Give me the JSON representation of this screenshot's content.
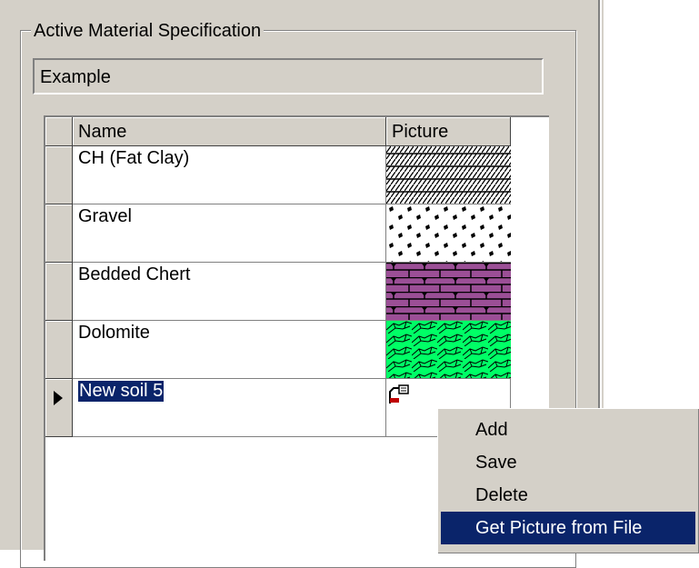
{
  "group": {
    "title": "Active Material Specification"
  },
  "name_field": {
    "value": "Example"
  },
  "grid": {
    "columns": [
      "Name",
      "Picture"
    ],
    "rows": [
      {
        "name": "CH (Fat Clay)",
        "pattern": "diagonal-hatch-icon"
      },
      {
        "name": "Gravel",
        "pattern": "gravel-dots-icon"
      },
      {
        "name": "Bedded Chert",
        "pattern": "chert-brick-icon"
      },
      {
        "name": "Dolomite",
        "pattern": "dolomite-cells-icon"
      },
      {
        "name": "New soil 5",
        "pattern": "paste-icon"
      }
    ],
    "current_row": 4
  },
  "context_menu": {
    "items": [
      "Add",
      "Save",
      "Delete",
      "Get Picture from File"
    ],
    "highlighted": 3
  },
  "colors": {
    "chert_fill": "#9b4f96",
    "dolomite_fill": "#00ff66",
    "selection": "#0a246a"
  }
}
